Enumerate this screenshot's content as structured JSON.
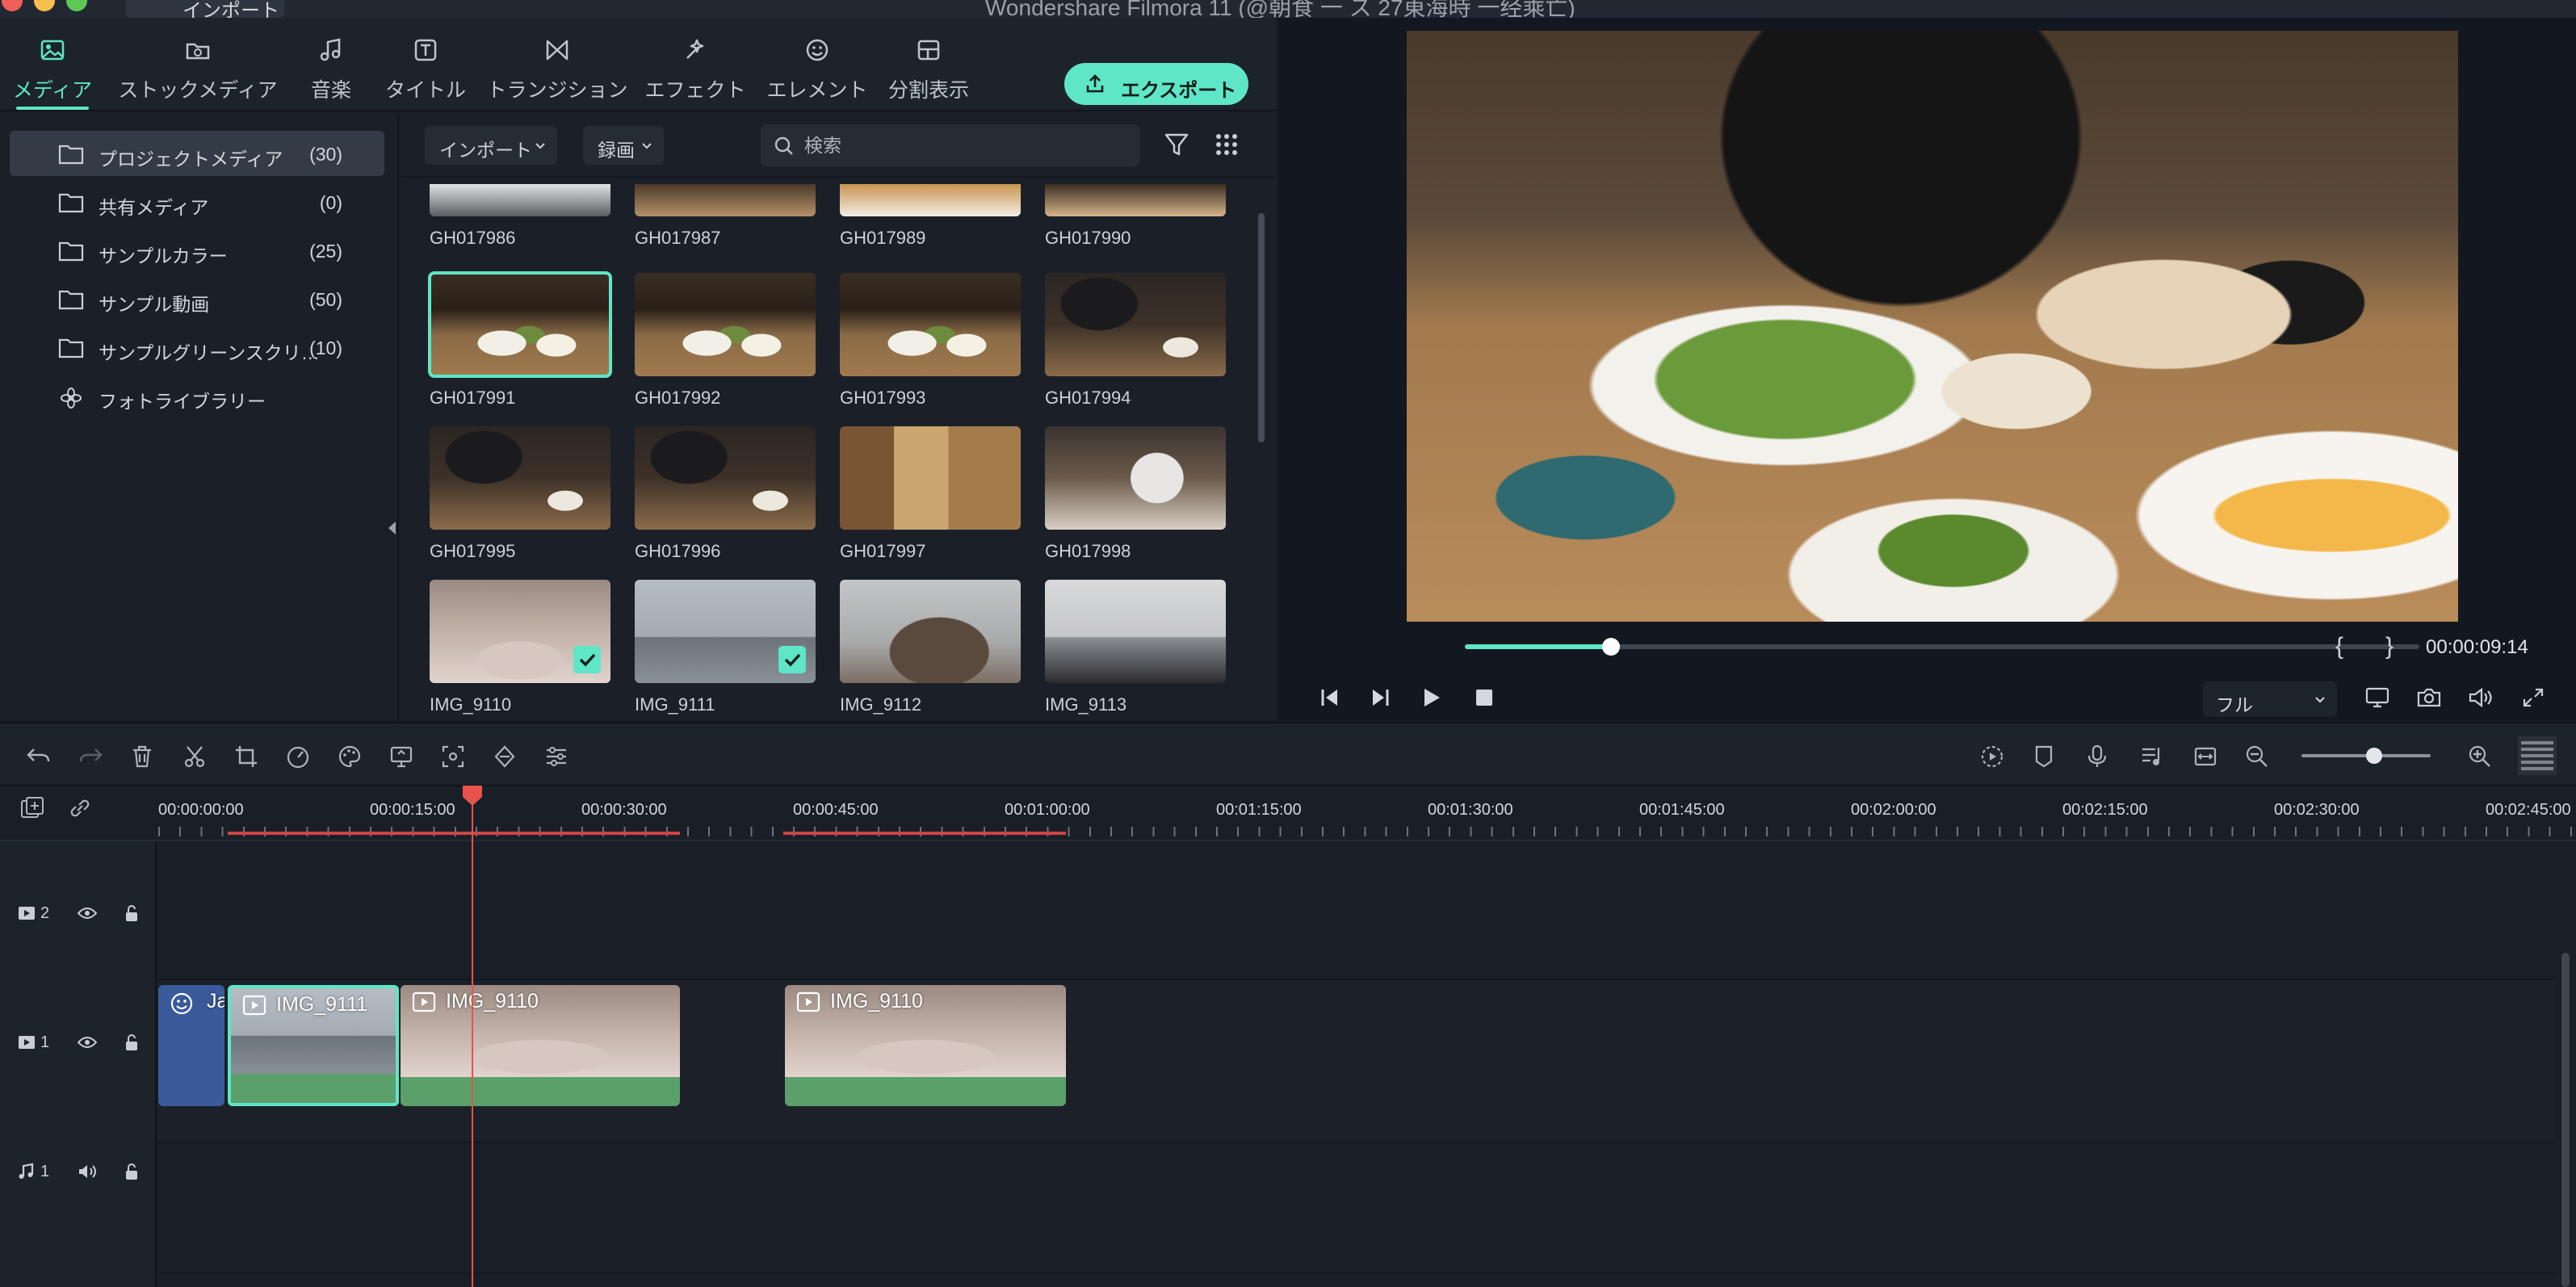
{
  "window": {
    "title": "Wondershare Filmora 11 (@朝食 一 ス 27東海時 一经乘亡)",
    "import_button": "インポート"
  },
  "nav": {
    "tabs": [
      {
        "label": "メディア",
        "icon": "media-icon",
        "active": true
      },
      {
        "label": "ストックメディア",
        "icon": "stock-media-icon"
      },
      {
        "label": "音楽",
        "icon": "music-icon"
      },
      {
        "label": "タイトル",
        "icon": "title-icon"
      },
      {
        "label": "トランジション",
        "icon": "transition-icon"
      },
      {
        "label": "エフェクト",
        "icon": "effect-icon"
      },
      {
        "label": "エレメント",
        "icon": "element-icon"
      },
      {
        "label": "分割表示",
        "icon": "split-screen-icon"
      }
    ],
    "export_label": "エクスポート"
  },
  "folders": [
    {
      "name": "プロジェクトメディア",
      "count": "(30)",
      "selected": true
    },
    {
      "name": "共有メディア",
      "count": "(0)"
    },
    {
      "name": "サンプルカラー",
      "count": "(25)"
    },
    {
      "name": "サンプル動画",
      "count": "(50)"
    },
    {
      "name": "サンプルグリーンスクリ…",
      "count": "(10)"
    },
    {
      "name": "フォトライブラリー",
      "count": ""
    }
  ],
  "browser": {
    "import_dd": "インポート",
    "record_dd": "録画",
    "search_placeholder": "検索",
    "rows": [
      [
        "GH017986",
        "GH017987",
        "GH017989",
        "GH017990"
      ],
      [
        "GH017991",
        "GH017992",
        "GH017993",
        "GH017994"
      ],
      [
        "GH017995",
        "GH017996",
        "GH017997",
        "GH017998"
      ],
      [
        "IMG_9110",
        "IMG_9111",
        "IMG_9112",
        "IMG_9113"
      ]
    ]
  },
  "preview": {
    "mark_in": "{",
    "mark_out": "}",
    "timecode": "00:00:09:14",
    "quality": "フル",
    "progress": 0.15
  },
  "ruler": [
    "00:00:00:00",
    "00:00:15:00",
    "00:00:30:00",
    "00:00:45:00",
    "00:01:00:00",
    "00:01:15:00",
    "00:01:30:00",
    "00:01:45:00",
    "00:02:00:00",
    "00:02:15:00",
    "00:02:30:00",
    "00:02:45:00"
  ],
  "tracks": {
    "video2": "2",
    "video1": "1",
    "audio1": "1"
  },
  "clips": {
    "c0": "Ja",
    "c1": "IMG_9111",
    "c2": "IMG_9110",
    "c3": "IMG_9110"
  },
  "colors": {
    "accent": "#5ee6c7",
    "playhead": "#e8524a",
    "clip_green": "#5ba06a",
    "clip_blue": "#3a5a9a"
  }
}
